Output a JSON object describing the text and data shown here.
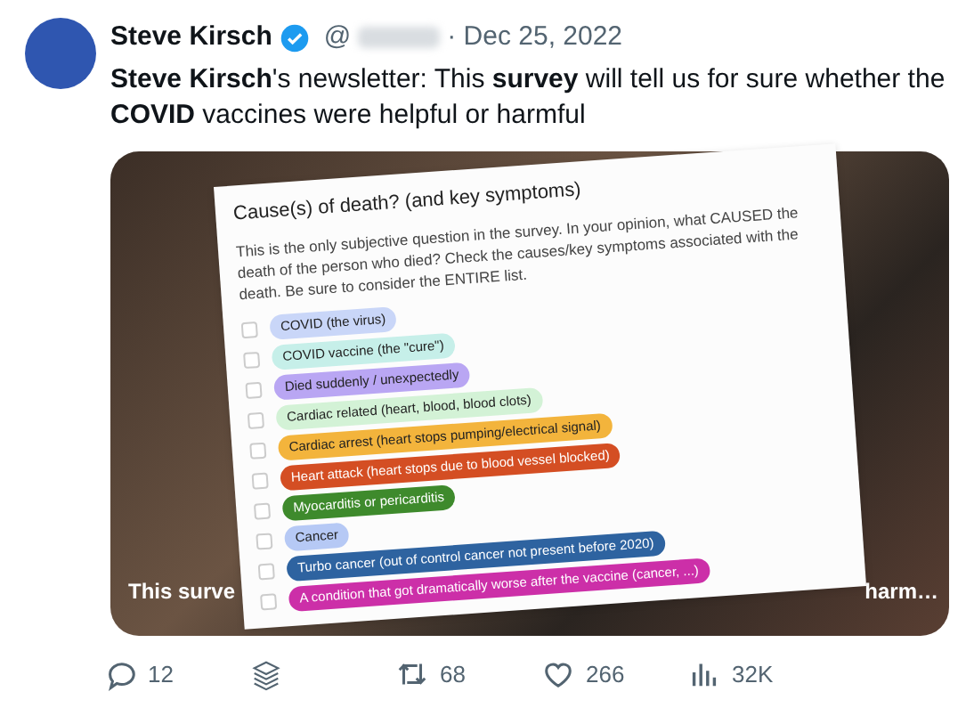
{
  "tweet": {
    "author": "Steve Kirsch",
    "verified": true,
    "handle": "@",
    "date": "· Dec 25, 2022",
    "text": "**Steve Kirsch**'s newsletter: This **survey** will tell us for sure whether the **COVID** vaccines were helpful or harmful"
  },
  "media": {
    "caption_left": "This surve",
    "caption_right": "harm…"
  },
  "survey": {
    "title": "Cause(s) of death? (and key symptoms)",
    "description": "This is the only subjective question in the survey. In your opinion, what CAUSED the death of the person who died? Check the causes/key symptoms associated with the death. Be sure to consider the ENTIRE list.",
    "options": [
      {
        "label": "COVID (the virus)",
        "color": "#c9d6f8",
        "checked": false
      },
      {
        "label": "COVID vaccine (the \"cure\")",
        "color": "#c6efe9",
        "checked": false
      },
      {
        "label": "Died suddenly / unexpectedly",
        "color": "#b9a6f3",
        "checked": false
      },
      {
        "label": "Cardiac related (heart, blood, blood clots)",
        "color": "#d3f2d6",
        "checked": false
      },
      {
        "label": "Cardiac arrest (heart stops pumping/electrical signal)",
        "color": "#f3b43c",
        "checked": false
      },
      {
        "label": "Heart attack (heart stops due to blood vessel blocked)",
        "color": "#d44e23",
        "checked": false
      },
      {
        "label": "Myocarditis or pericarditis",
        "color": "#3e8a2c",
        "checked": false
      },
      {
        "label": "Cancer",
        "color": "#b6c9f5",
        "checked": false
      },
      {
        "label": "Turbo cancer (out of control cancer not present before 2020)",
        "color": "#2e63a0",
        "checked": false
      },
      {
        "label": "A condition that got dramatically worse after the vaccine (cancer, ...)",
        "color": "#cc2fa8",
        "checked": false
      }
    ]
  },
  "actions": [
    {
      "kind": "reply",
      "count": "12"
    },
    {
      "kind": "layers"
    },
    {
      "kind": "repost",
      "count": "68"
    },
    {
      "kind": "like",
      "count": "266"
    },
    {
      "kind": "views",
      "count": "32K"
    }
  ]
}
